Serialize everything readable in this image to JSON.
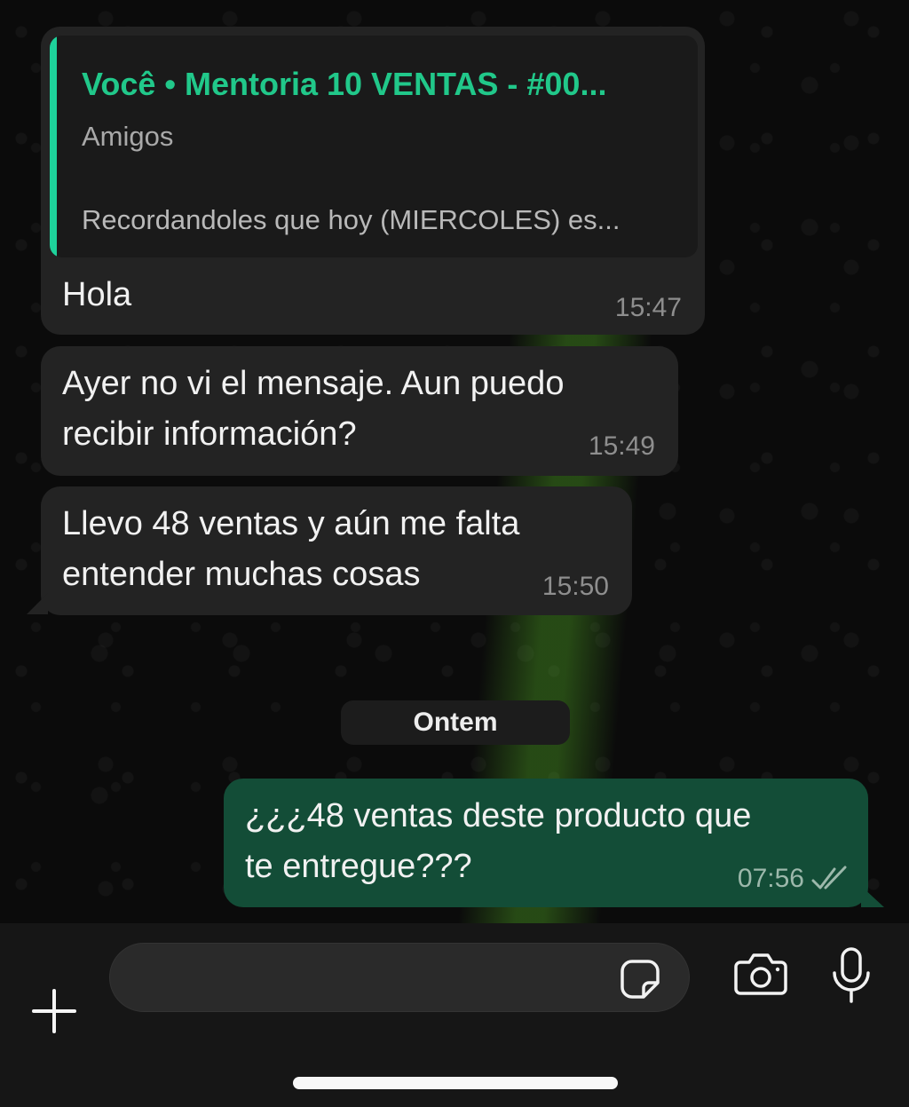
{
  "colors": {
    "incoming_bubble": "#232323",
    "outgoing_bubble": "#134d37",
    "quote_accent": "#1ed29b",
    "background": "#0b0b0b"
  },
  "messages": [
    {
      "direction": "incoming",
      "quote": {
        "title": "Você • Mentoria 10 VENTAS - #00...",
        "subtitle": "Amigos",
        "preview": "Recordandoles que hoy (MIERCOLES) es..."
      },
      "lines": [
        "Hola"
      ],
      "time": "15:47"
    },
    {
      "direction": "incoming",
      "lines": [
        "Ayer no vi el mensaje. Aun puedo",
        "recibir información?"
      ],
      "time": "15:49"
    },
    {
      "direction": "incoming",
      "lines": [
        "Llevo 48 ventas y aún me falta",
        "entender muchas cosas"
      ],
      "time": "15:50"
    },
    {
      "direction": "outgoing",
      "lines": [
        "¿¿¿48 ventas deste producto que",
        "te entregue???"
      ],
      "time": "07:56",
      "status_icon": "double-check-icon"
    }
  ],
  "date_separator": "Ontem",
  "composer": {
    "placeholder": "",
    "icons": [
      "plus-icon",
      "sticker-icon",
      "camera-icon",
      "microphone-icon"
    ]
  }
}
